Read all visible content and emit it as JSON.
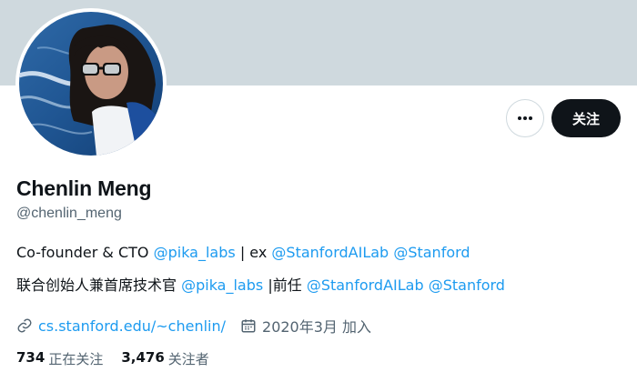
{
  "profile": {
    "name": "Chenlin Meng",
    "handle": "@chenlin_meng",
    "follow_label": "关注",
    "more_label": "•••"
  },
  "bio": {
    "line1": {
      "prefix": "Co-founder & CTO ",
      "mention1": "@pika_labs",
      "middle": " | ex ",
      "mention2": "@StanfordAILab",
      "space": " ",
      "mention3": "@Stanford"
    },
    "line2": {
      "prefix": "联合创始人兼首席技术官 ",
      "mention1": "@pika_labs",
      "middle": " |前任 ",
      "mention2": "@StanfordAILab",
      "space": " ",
      "mention3": "@Stanford"
    }
  },
  "meta": {
    "website": "cs.stanford.edu/~chenlin/",
    "joined": "2020年3月 加入"
  },
  "counts": {
    "following_num": "734",
    "following_label": "正在关注",
    "followers_num": "3,476",
    "followers_label": "关注者"
  },
  "colors": {
    "banner": "#cfd9de",
    "link": "#1d9bf0",
    "button_dark": "#0f1419",
    "secondary_text": "#536471"
  },
  "icons": [
    "more-icon",
    "link-icon",
    "calendar-icon"
  ]
}
